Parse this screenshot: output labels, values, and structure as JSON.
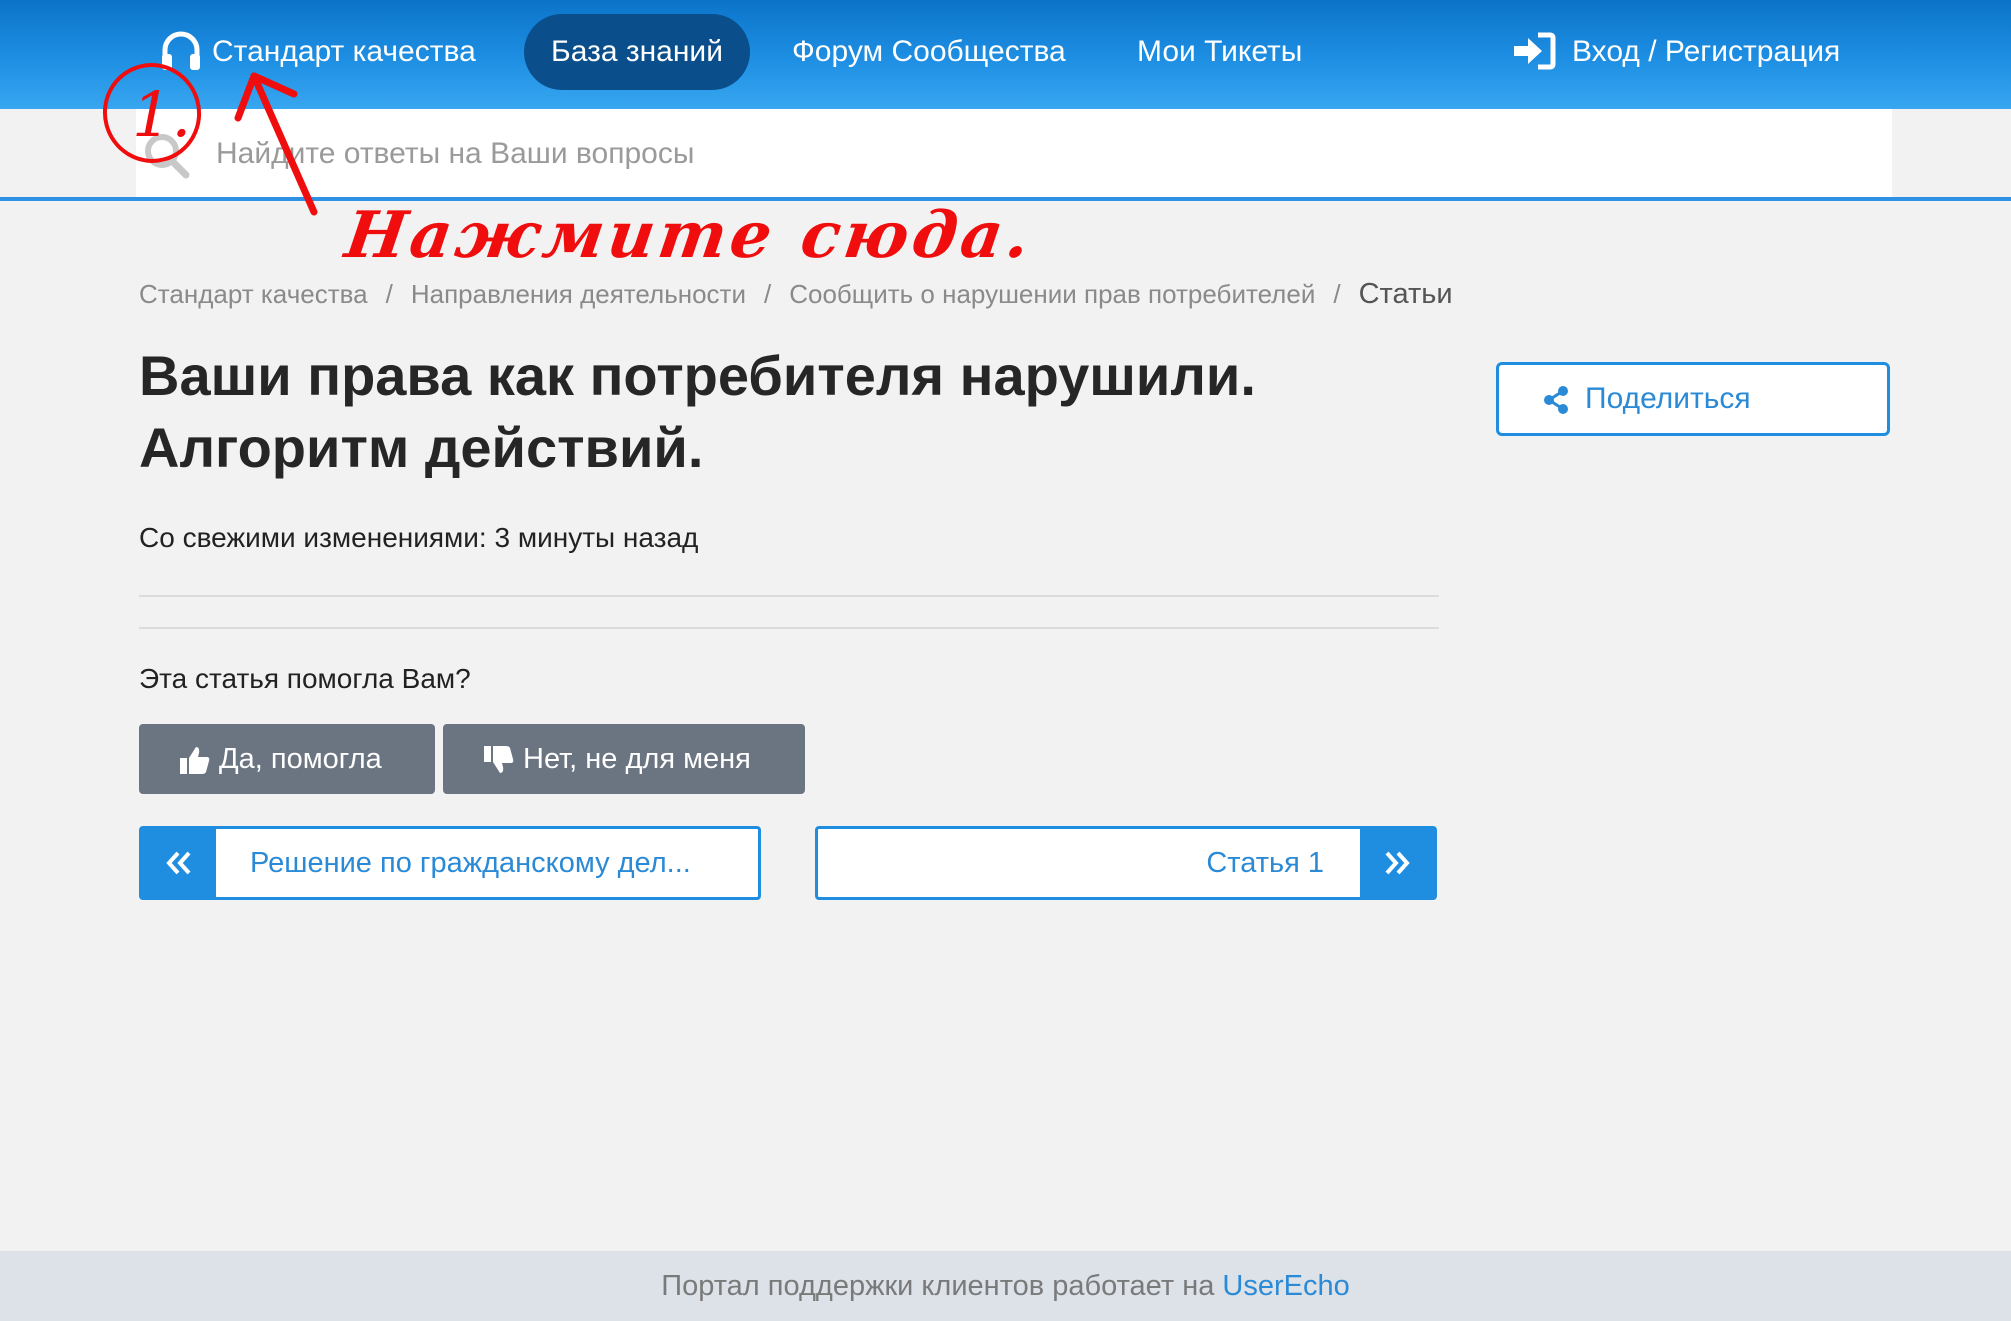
{
  "nav": {
    "brand_label": "Стандарт качества",
    "knowledge_base": "База знаний",
    "forum": "Форум Сообщества",
    "tickets": "Мои Тикеты",
    "login": "Вход / Регистрация"
  },
  "search": {
    "placeholder": "Найдите ответы на Ваши вопросы"
  },
  "breadcrumb": [
    "Стандарт качества",
    "Направления деятельности",
    "Сообщить о нарушении прав потребителей",
    "Статьи"
  ],
  "breadcrumb_separator": "/",
  "article": {
    "title_line1": "Ваши права как потребителя нарушили.",
    "title_line2": "Алгоритм действий.",
    "updated": "Со свежими изменениями: 3 минуты назад"
  },
  "feedback": {
    "question": "Эта статья помогла Вам?",
    "yes": "Да, помогла",
    "no": "Нет, не для меня"
  },
  "pager": {
    "prev": "Решение по гражданскому дел...",
    "next": "Статья 1"
  },
  "share": {
    "label": "Поделиться"
  },
  "footer": {
    "text": "Портал поддержки клиентов работает на",
    "link": "UserEcho"
  },
  "annotation": {
    "number": "1.",
    "text": "Нажмите сюда."
  },
  "colors": {
    "nav_gradient_top": "#0b74c9",
    "nav_active_pill": "#0a4f8c",
    "accent_blue": "#1f8de0",
    "vote_button": "#6b7481",
    "annotation_red": "#f00d0d",
    "footer_bg": "#dde2e8"
  },
  "icons": {
    "brand": "headphones-icon",
    "login": "sign-in-icon",
    "search": "search-icon",
    "share": "share-icon",
    "yes": "thumbs-up-icon",
    "no": "thumbs-down-icon",
    "prev": "double-chevron-left-icon",
    "next": "double-chevron-right-icon"
  }
}
